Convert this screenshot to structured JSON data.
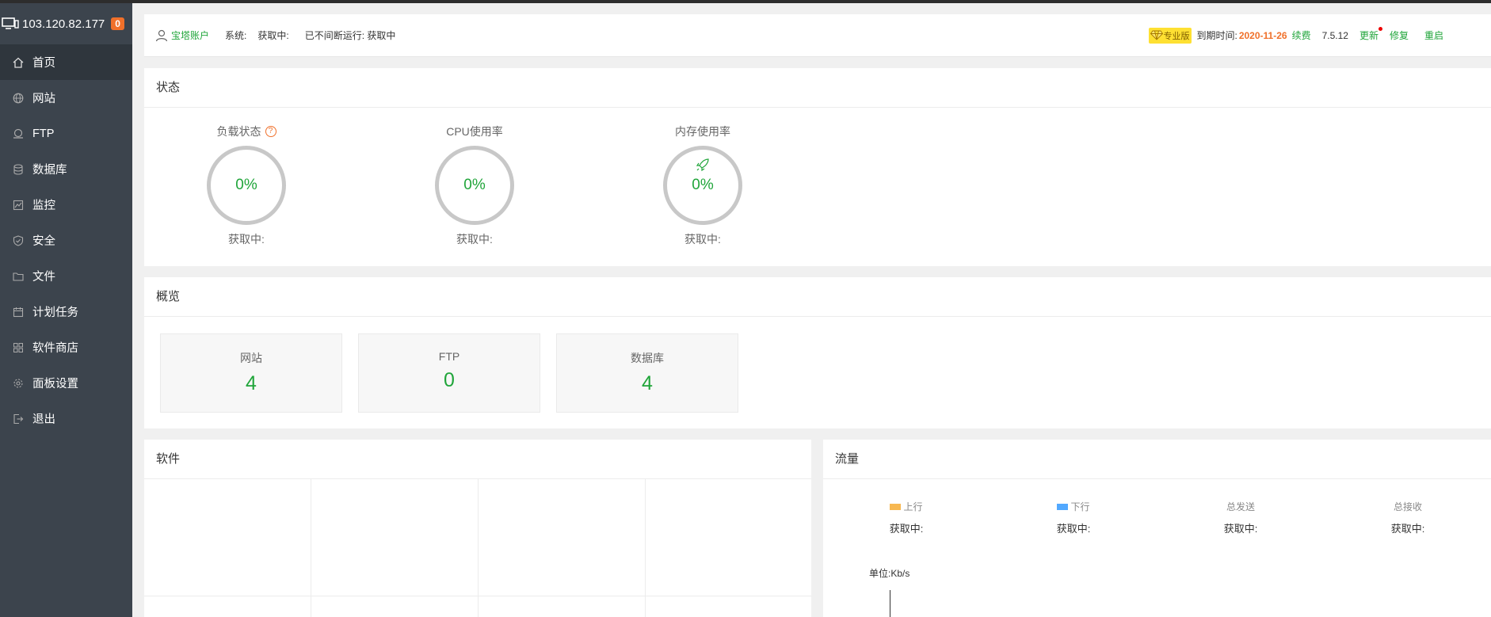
{
  "server": {
    "ip": "103.120.82.177",
    "badge": "0"
  },
  "sidebar": {
    "items": [
      {
        "label": "首页",
        "icon": "home-icon"
      },
      {
        "label": "网站",
        "icon": "globe-icon"
      },
      {
        "label": "FTP",
        "icon": "ftp-icon"
      },
      {
        "label": "数据库",
        "icon": "database-icon"
      },
      {
        "label": "监控",
        "icon": "monitor-icon"
      },
      {
        "label": "安全",
        "icon": "shield-icon"
      },
      {
        "label": "文件",
        "icon": "folder-icon"
      },
      {
        "label": "计划任务",
        "icon": "calendar-icon"
      },
      {
        "label": "软件商店",
        "icon": "apps-icon"
      },
      {
        "label": "面板设置",
        "icon": "gear-icon"
      },
      {
        "label": "退出",
        "icon": "logout-icon"
      }
    ]
  },
  "header": {
    "account": "宝塔账户",
    "system_label": "系统:",
    "system_value": "获取中:",
    "uptime": "已不间断运行: 获取中",
    "pro_label": "专业版",
    "expire_label": "到期时间:",
    "expire_date": "2020-11-26",
    "renew": "续费",
    "version": "7.5.12",
    "update": "更新",
    "repair": "修复",
    "restart": "重启"
  },
  "status": {
    "title": "状态",
    "gauges": [
      {
        "label": "负载状态",
        "value": "0%",
        "sub": "获取中:"
      },
      {
        "label": "CPU使用率",
        "value": "0%",
        "sub": "获取中:"
      },
      {
        "label": "内存使用率",
        "value": "0%",
        "sub": "获取中:"
      }
    ]
  },
  "overview": {
    "title": "概览",
    "cards": [
      {
        "label": "网站",
        "value": "4"
      },
      {
        "label": "FTP",
        "value": "0"
      },
      {
        "label": "数据库",
        "value": "4"
      }
    ]
  },
  "software": {
    "title": "软件"
  },
  "traffic": {
    "title": "流量",
    "cols": [
      {
        "label": "上行",
        "value": "获取中:"
      },
      {
        "label": "下行",
        "value": "获取中:"
      },
      {
        "label": "总发送",
        "value": "获取中:"
      },
      {
        "label": "总接收",
        "value": "获取中:"
      }
    ],
    "unit": "单位:Kb/s",
    "colors": {
      "up": "#f7b851",
      "down": "#52a9ff"
    }
  }
}
